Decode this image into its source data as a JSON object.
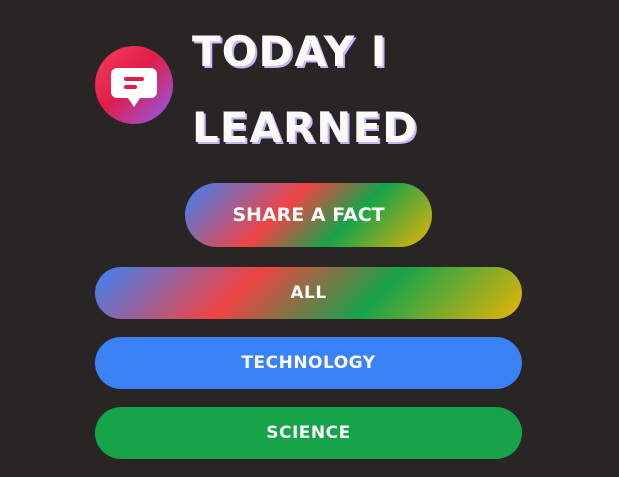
{
  "header": {
    "title_line1": "TODAY I",
    "title_line2": "LEARNED",
    "logo_icon": "speech-bubble-icon"
  },
  "share_button": {
    "label": "SHARE A FACT"
  },
  "categories": [
    {
      "label": "ALL",
      "color": "gradient"
    },
    {
      "label": "TECHNOLOGY",
      "color": "#3b82f6"
    },
    {
      "label": "SCIENCE",
      "color": "#16a34a"
    }
  ],
  "colors": {
    "background": "#292524",
    "text": "#fafaf9",
    "technology": "#3b82f6",
    "science": "#16a34a",
    "gradient_stops": [
      "#3b82f6",
      "#ef4444",
      "#16a34a",
      "#eab308"
    ]
  }
}
